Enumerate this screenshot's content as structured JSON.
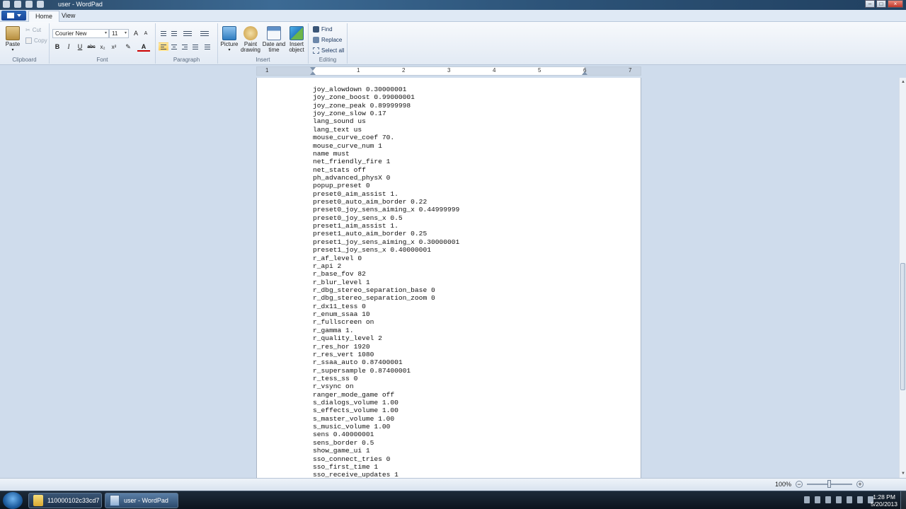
{
  "window": {
    "title": "user - WordPad"
  },
  "tabs": [
    {
      "label": "Home"
    },
    {
      "label": "View"
    }
  ],
  "ribbon": {
    "clipboard": {
      "paste": "Paste",
      "cut": "Cut",
      "copy": "Copy",
      "label": "Clipboard"
    },
    "font": {
      "family": "Courier New",
      "size": "11",
      "label": "Font",
      "buttons": {
        "bold": "B",
        "italic": "I",
        "underline": "U",
        "strike": "abc",
        "sub": "x₂",
        "sup": "x²",
        "color": "A"
      }
    },
    "paragraph": {
      "label": "Paragraph"
    },
    "insert": {
      "picture": "Picture",
      "paint1": "Paint",
      "paint2": "drawing",
      "date1": "Date and",
      "date2": "time",
      "object1": "Insert",
      "object2": "object",
      "label": "Insert"
    },
    "editing": {
      "find": "Find",
      "replace": "Replace",
      "select_all": "Select all",
      "label": "Editing"
    }
  },
  "ruler": {
    "numbers": [
      "1",
      "1",
      "2",
      "3",
      "4",
      "5",
      "6",
      "7"
    ]
  },
  "document": {
    "lines": [
      "joy_alowdown 0.30000001",
      "joy_zone_boost 0.99000001",
      "joy_zone_peak 0.89999998",
      "joy_zone_slow 0.17",
      "lang_sound us",
      "lang_text us",
      "mouse_curve_coef 70.",
      "mouse_curve_num 1",
      "name must",
      "net_friendly_fire 1",
      "net_stats off",
      "ph_advanced_physX 0",
      "popup_preset 0",
      "preset0_aim_assist 1.",
      "preset0_auto_aim_border 0.22",
      "preset0_joy_sens_aiming_x 0.44999999",
      "preset0_joy_sens_x 0.5",
      "preset1_aim_assist 1.",
      "preset1_auto_aim_border 0.25",
      "preset1_joy_sens_aiming_x 0.30000001",
      "preset1_joy_sens_x 0.40000001",
      "r_af_level 0",
      "r_api 2",
      "r_base_fov 82",
      "r_blur_level 1",
      "r_dbg_stereo_separation_base 0",
      "r_dbg_stereo_separation_zoom 0",
      "r_dx11_tess 0",
      "r_enum_ssaa 10",
      "r_fullscreen on",
      "r_gamma 1.",
      "r_quality_level 2",
      "r_res_hor 1920",
      "r_res_vert 1080",
      "r_ssaa_auto 0.87400001",
      "r_supersample 0.87400001",
      "r_tess_ss 0",
      "r_vsync on",
      "ranger_mode_game off",
      "s_dialogs_volume 1.00",
      "s_effects_volume 1.00",
      "s_master_volume 1.00",
      "s_music_volume 1.00",
      "sens 0.40000001",
      "sens_border 0.5",
      "show_game_ui 1",
      "sso_connect_tries 0",
      "sso_first_time 1",
      "sso_receive_updates 1"
    ]
  },
  "status": {
    "zoom": "100%",
    "zoom_minus": "−",
    "zoom_plus": "+",
    "zoom_level": 0.5
  },
  "taskbar": {
    "items": [
      {
        "label": "110000102c33cd7"
      },
      {
        "label": "user - WordPad"
      }
    ],
    "time": "1:28 PM",
    "date": "5/20/2013"
  }
}
